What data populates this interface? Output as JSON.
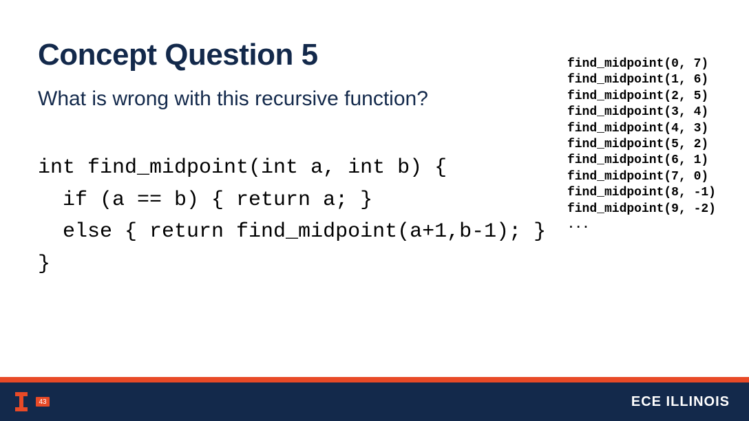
{
  "title": "Concept Question 5",
  "question": "What is wrong with this recursive function?",
  "code": "int find_midpoint(int a, int b) {\n  if (a == b) { return a; }\n  else { return find_midpoint(a+1,b-1); }\n}",
  "trace": "find_midpoint(0, 7)\nfind_midpoint(1, 6)\nfind_midpoint(2, 5)\nfind_midpoint(3, 4)\nfind_midpoint(4, 3)\nfind_midpoint(5, 2)\nfind_midpoint(6, 1)\nfind_midpoint(7, 0)\nfind_midpoint(8, -1)\nfind_midpoint(9, -2)\n...",
  "footer": {
    "page_number": "43",
    "dept_prefix": "ECE",
    "dept_suffix": " ILLINOIS"
  },
  "colors": {
    "navy": "#13294b",
    "orange": "#e84a27"
  }
}
